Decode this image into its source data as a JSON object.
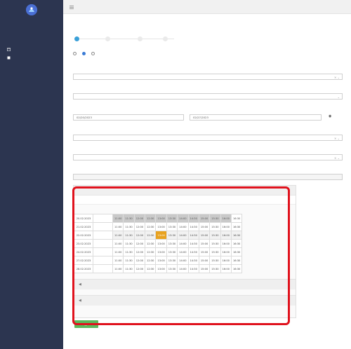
{
  "sidebar": {
    "title": "",
    "items": [
      {
        "label": ""
      },
      {
        "label": ""
      },
      {
        "label": ""
      },
      {
        "label": ""
      }
    ]
  },
  "page": {
    "title": ""
  },
  "wizard": {
    "steps": [
      {
        "label": ""
      },
      {
        "label": ""
      },
      {
        "label": ""
      },
      {
        "label": ""
      }
    ]
  },
  "radios": [
    {
      "label": "",
      "checked": false
    },
    {
      "label": "",
      "checked": true
    },
    {
      "label": "",
      "checked": false
    }
  ],
  "form": {
    "service_label": "",
    "service_value": "",
    "visit_type_label": "",
    "visit_type_value": "",
    "period_label": "",
    "date_from": "02/20/2023",
    "date_to": "02/27/2023",
    "branch_label": "",
    "branch_value": "",
    "doctor_label": "",
    "doctor_value": "",
    "note_label": "",
    "note_value": ""
  },
  "schedule": {
    "header": "",
    "title_highlight": "",
    "title_rest": "",
    "times": [
      "11:00",
      "11:30",
      "12:00",
      "12:30",
      "13:00",
      "13:30",
      "14:00",
      "14:30",
      "15:00",
      "15:30",
      "16:00",
      "16:30"
    ],
    "rows": [
      {
        "date": "20.02.2023",
        "day": "",
        "highlight": -1
      },
      {
        "date": "21.02.2023",
        "day": "",
        "highlight": -1
      },
      {
        "date": "22.02.2023",
        "day": "",
        "highlight": 4
      },
      {
        "date": "23.02.2023",
        "day": "",
        "highlight": -1
      },
      {
        "date": "24.02.2023",
        "day": "",
        "highlight": -1
      },
      {
        "date": "27.02.2023",
        "day": "",
        "highlight": -1
      },
      {
        "date": "28.02.2023",
        "day": "",
        "highlight": -1
      }
    ],
    "highlight_color": "#e8a21f"
  },
  "actions": {
    "save_label": ""
  },
  "colors": {
    "sidebar": "#2c3550",
    "accent": "#3aa0d8",
    "frame": "#e0121d",
    "save": "#5cb85c"
  }
}
